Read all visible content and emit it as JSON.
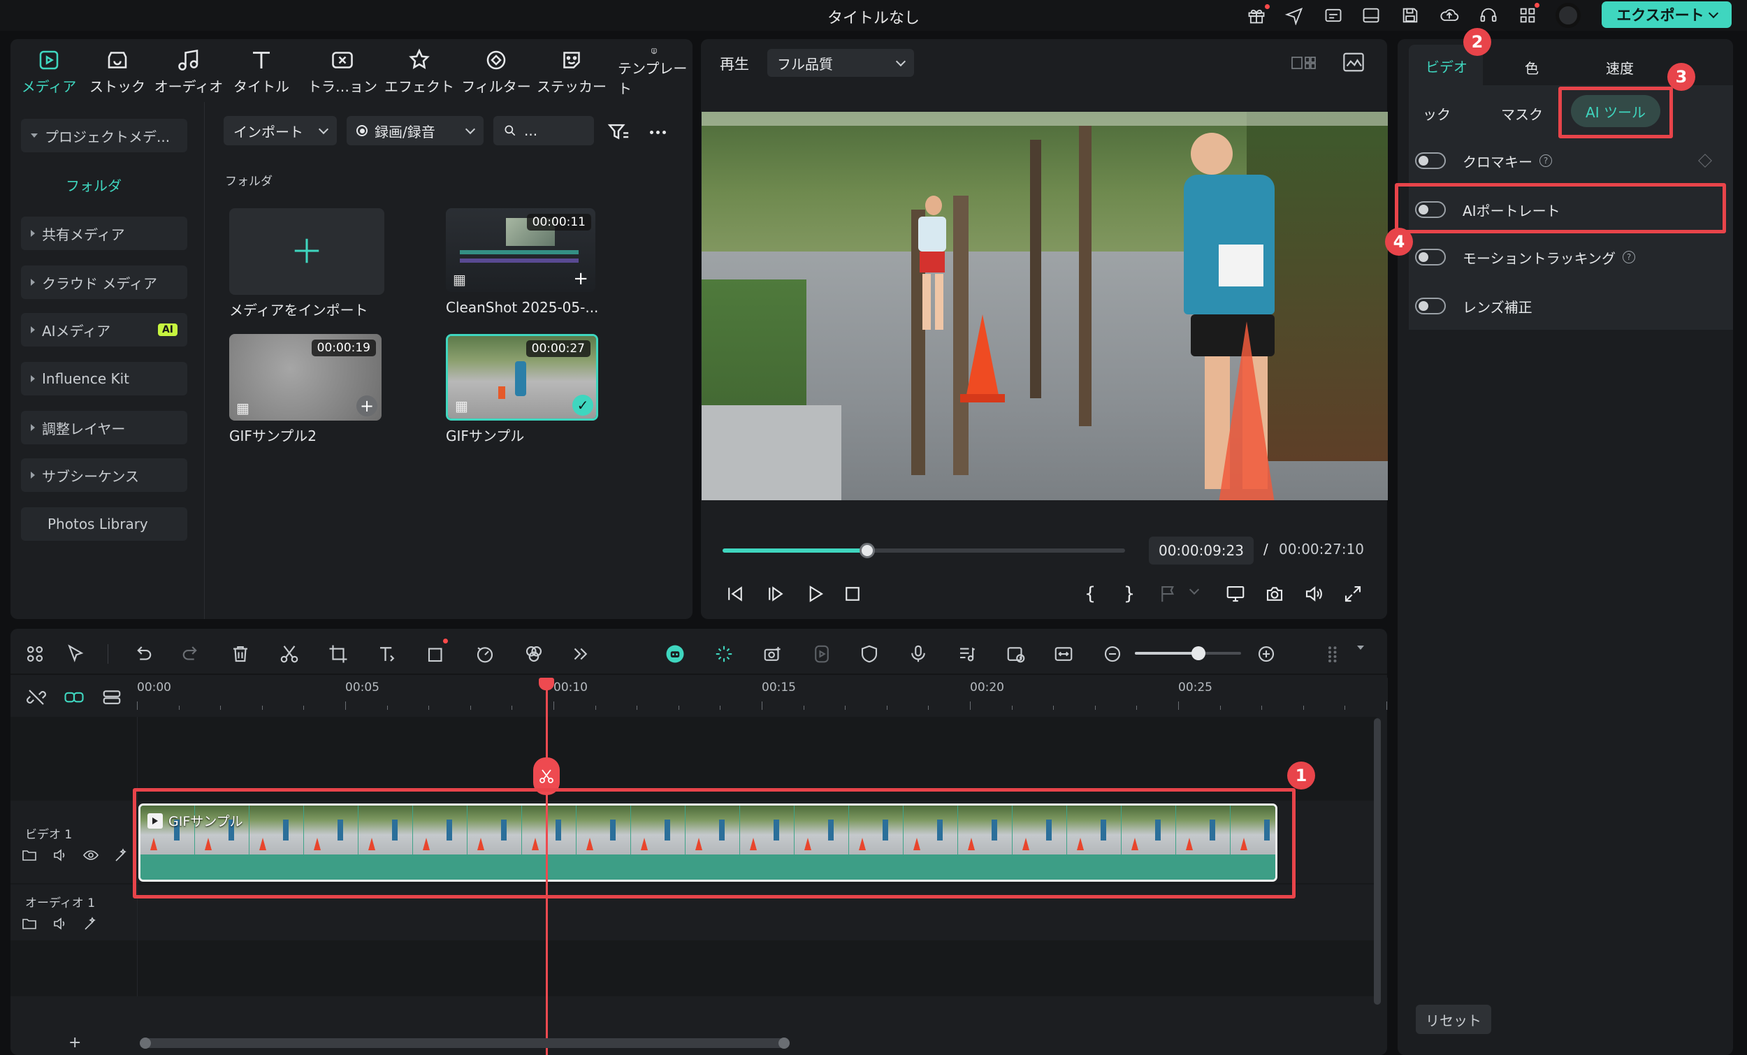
{
  "window": {
    "title": "タイトルなし",
    "export_label": "エクスポート"
  },
  "top_nav": [
    {
      "label": "メディア",
      "icon": "media-icon"
    },
    {
      "label": "ストック",
      "icon": "stock-icon"
    },
    {
      "label": "オーディオ",
      "icon": "music-note-icon"
    },
    {
      "label": "タイトル",
      "icon": "title-icon"
    },
    {
      "label": "トラ…ョン",
      "icon": "transition-icon"
    },
    {
      "label": "エフェクト",
      "icon": "effect-icon"
    },
    {
      "label": "フィルター",
      "icon": "filter-icon"
    },
    {
      "label": "ステッカー",
      "icon": "sticker-icon"
    },
    {
      "label": "テンプレート",
      "icon": "template-icon"
    }
  ],
  "sidebar": {
    "project_media": "プロジェクトメデ...",
    "folder": "フォルダ",
    "items": [
      {
        "label": "共有メディア"
      },
      {
        "label": "クラウド メディア"
      },
      {
        "label": "AIメディア",
        "badge": "AI"
      },
      {
        "label": "Influence Kit"
      },
      {
        "label": "調整レイヤー"
      },
      {
        "label": "サブシーケンス"
      }
    ],
    "photos_library": "Photos Library"
  },
  "media_toolbar": {
    "import": "インポート",
    "record": "録画/録音",
    "search_placeholder": "..."
  },
  "media_section_label": "フォルダ",
  "media_items": [
    {
      "label": "メディアをインポート"
    },
    {
      "label": "CleanShot 2025-05-...",
      "duration": "00:00:11"
    },
    {
      "label": "GIFサンプル2",
      "duration": "00:00:19"
    },
    {
      "label": "GIFサンプル",
      "duration": "00:00:27"
    }
  ],
  "preview": {
    "play_label": "再生",
    "quality": "フル品質",
    "current_time": "00:00:09:23",
    "separator": "/",
    "total_time": "00:00:27:10",
    "progress": 0.36
  },
  "props": {
    "tabs": [
      "ビデオ",
      "色",
      "速度"
    ],
    "sub_tabs": [
      "ック",
      "マスク",
      "AI ツール"
    ],
    "rows": [
      {
        "label": "クロマキー",
        "help": true
      },
      {
        "label": "AIポートレート",
        "help": false
      },
      {
        "label": "モーショントラッキング",
        "help": true
      },
      {
        "label": "レンズ補正",
        "help": false
      }
    ],
    "reset": "リセット"
  },
  "timeline": {
    "ruler": [
      "00:00",
      "00:05",
      "00:10",
      "00:15",
      "00:20",
      "00:25"
    ],
    "video_track": "ビデオ 1",
    "audio_track": "オーディオ 1",
    "clip_label": "GIFサンプル",
    "playhead_time_fraction": 0.36,
    "zoom_level": 0.6
  },
  "annotations": [
    "1",
    "2",
    "3",
    "4"
  ],
  "colors": {
    "accent": "#3fd6bf",
    "highlight": "#e8444a",
    "panel": "#1c1e21"
  }
}
